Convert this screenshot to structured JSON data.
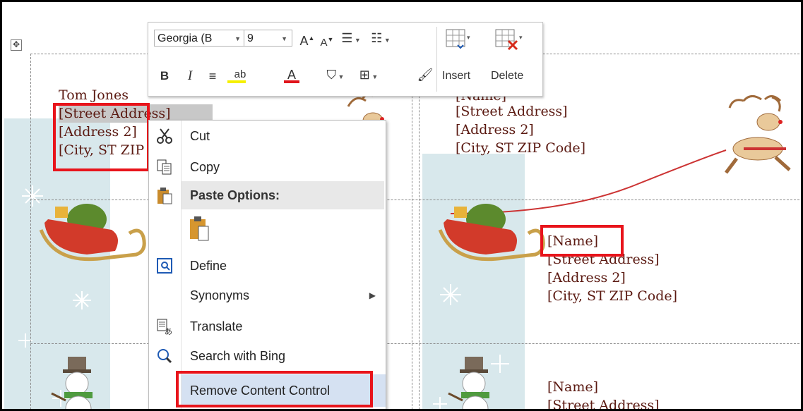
{
  "toolbar": {
    "font_name": "Georgia (B",
    "font_size": "9",
    "insert_label": "Insert",
    "delete_label": "Delete",
    "bold": "B",
    "italic": "I",
    "font_color_letter": "A",
    "grow_font_letter": "A",
    "shrink_font_letter": "A"
  },
  "labels": [
    {
      "lines": [
        "Tom Jones",
        "[Street Address]",
        "[Address 2]",
        "[City, ST  ZIP Code]"
      ]
    },
    {
      "lines": [
        "[Name]",
        "[Street Address]",
        "[Address 2]",
        "[City, ST  ZIP Code]"
      ]
    },
    {
      "lines": [
        "[Name]",
        "[Street Address]",
        "[Address 2]",
        "[City, ST  ZIP Code]"
      ]
    },
    {
      "lines": [
        "[Name]",
        "[Street Address]"
      ]
    }
  ],
  "context_menu": {
    "cut": "Cut",
    "copy": "Copy",
    "paste_options": "Paste Options:",
    "define": "Define",
    "synonyms": "Synonyms",
    "translate": "Translate",
    "search": "Search with Bing",
    "remove_content_control": "Remove Content Control"
  },
  "colors": {
    "label_text": "#5b1a12",
    "highlight_box": "#e8141b",
    "menu_hover": "#d5e1f2",
    "winter_band": "#d8e8ec"
  },
  "icons": [
    "table-move-icon",
    "grow-font-icon",
    "shrink-font-icon",
    "bullets-icon",
    "numbering-icon",
    "highlight-icon",
    "font-color-icon",
    "shading-icon",
    "borders-icon",
    "format-painter-icon",
    "insert-table-icon",
    "delete-table-icon",
    "cut-icon",
    "copy-icon",
    "paste-icon",
    "define-icon",
    "translate-icon",
    "search-icon",
    "submenu-arrow-icon",
    "reindeer-icon",
    "sleigh-icon",
    "snowman-icon"
  ]
}
